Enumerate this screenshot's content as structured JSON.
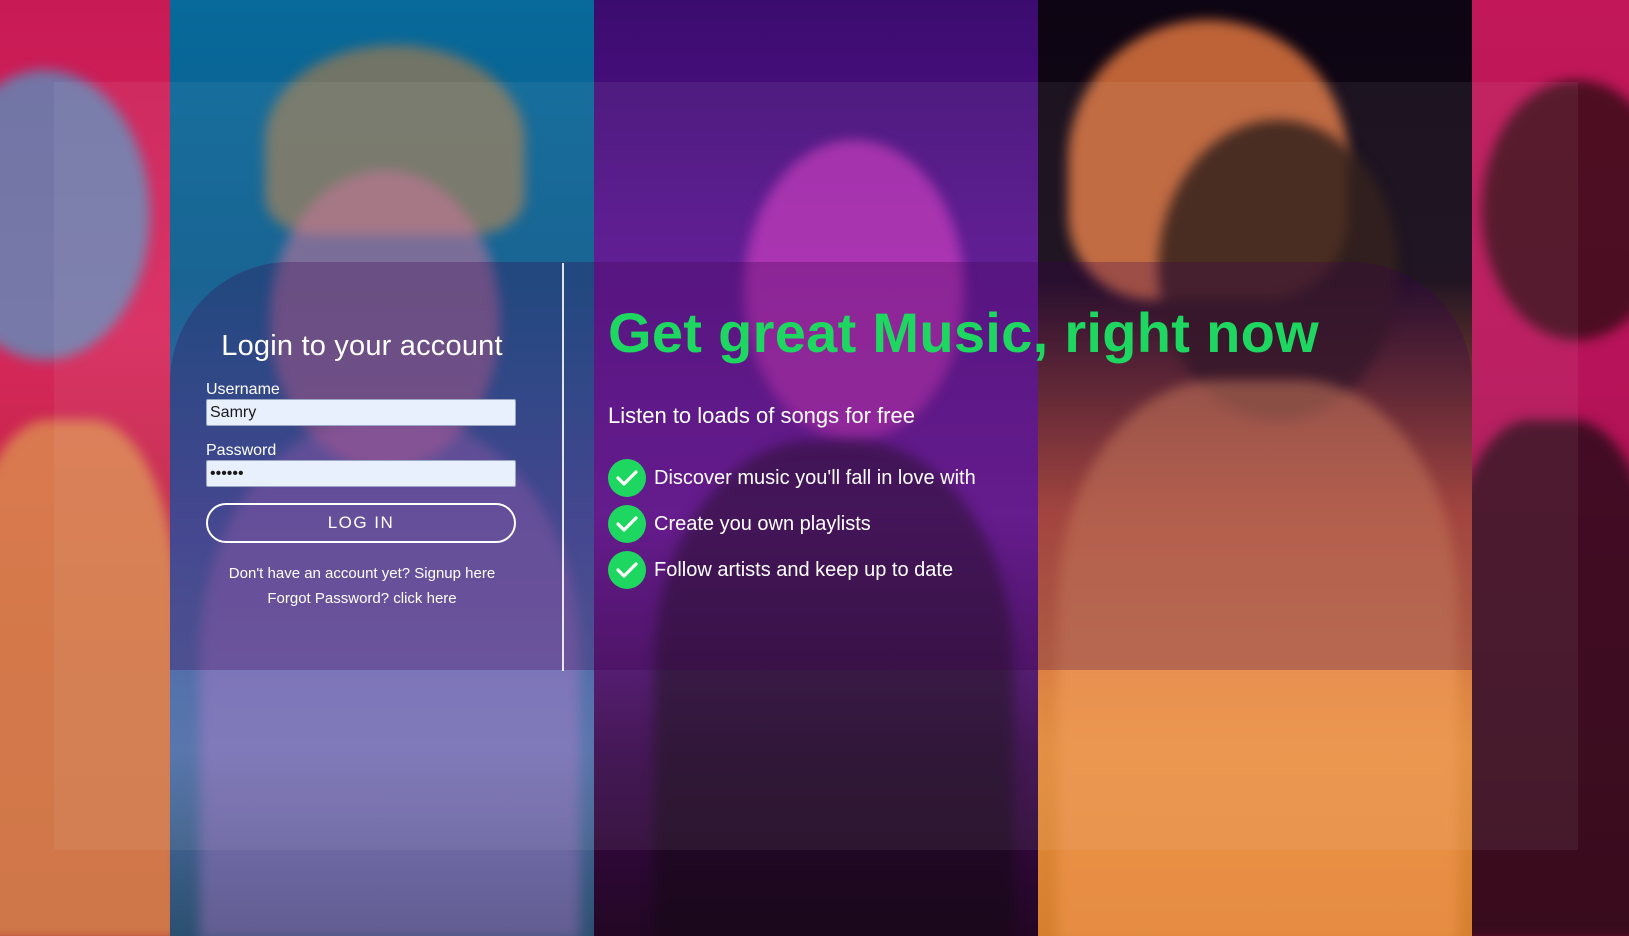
{
  "login": {
    "title": "Login to your account",
    "username_label": "Username",
    "username_value": "Samry",
    "password_label": "Password",
    "password_value": "••••••",
    "login_button": "LOG IN",
    "signup_text": "Don't have an account yet? Signup here",
    "forgot_text": "Forgot Password? click here"
  },
  "promo": {
    "headline": "Get great Music, right now",
    "subhead": "Listen to loads of songs for free",
    "features": [
      {
        "icon": "check-circle-icon",
        "label": "Discover music you'll fall in love with"
      },
      {
        "icon": "check-circle-icon",
        "label": "Create you own playlists"
      },
      {
        "icon": "check-circle-icon",
        "label": "Follow artists and keep up to date"
      }
    ]
  },
  "colors": {
    "accent": "#1ed760",
    "text": "#ffffff",
    "input_bg": "#e8f0fe"
  }
}
